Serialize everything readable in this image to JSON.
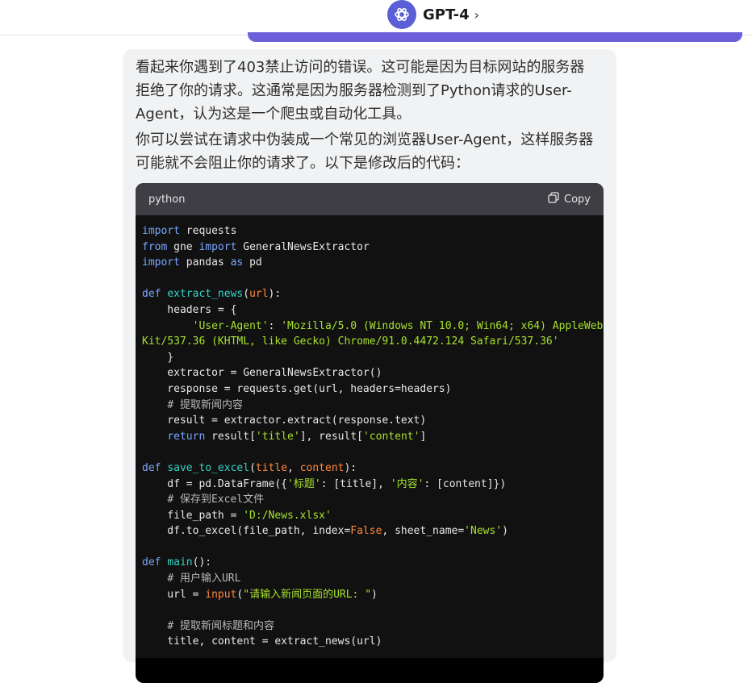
{
  "header": {
    "model": "GPT-4",
    "chevron": "›",
    "logo_icon": "openai-logo"
  },
  "message": {
    "para1": "看起来你遇到了403禁止访问的错误。这可能是因为目标网站的服务器拒绝了你的请求。这通常是因为服务器检测到了Python请求的User-Agent，认为这是一个爬虫或自动化工具。",
    "para2": "你可以尝试在请求中伪装成一个常见的浏览器User-Agent，这样服务器可能就不会阻止你的请求了。以下是修改后的代码："
  },
  "code_block": {
    "language": "python",
    "copy_label": "Copy",
    "copy_icon": "copy-icon",
    "lines": [
      [
        [
          "k",
          "import"
        ],
        [
          "p",
          " requests"
        ]
      ],
      [
        [
          "k",
          "from"
        ],
        [
          "p",
          " gne "
        ],
        [
          "k",
          "import"
        ],
        [
          "p",
          " GeneralNewsExtractor"
        ]
      ],
      [
        [
          "k",
          "import"
        ],
        [
          "p",
          " pandas "
        ],
        [
          "k",
          "as"
        ],
        [
          "p",
          " pd"
        ]
      ],
      [],
      [
        [
          "k",
          "def"
        ],
        [
          "p",
          " "
        ],
        [
          "f",
          "extract_news"
        ],
        [
          "p",
          "("
        ],
        [
          "o",
          "url"
        ],
        [
          "p",
          "):"
        ]
      ],
      [
        [
          "p",
          "    headers = {"
        ]
      ],
      [
        [
          "p",
          "        "
        ],
        [
          "s",
          "'User-Agent'"
        ],
        [
          "p",
          ": "
        ],
        [
          "s",
          "'Mozilla/5.0 (Windows NT 10.0; Win64; x64) AppleWeb"
        ]
      ],
      [
        [
          "s",
          "Kit/537.36 (KHTML, like Gecko) Chrome/91.0.4472.124 Safari/537.36'"
        ]
      ],
      [
        [
          "p",
          "    }"
        ]
      ],
      [
        [
          "p",
          "    extractor = GeneralNewsExtractor()"
        ]
      ],
      [
        [
          "p",
          "    response = requests.get(url, headers=headers)"
        ]
      ],
      [
        [
          "p",
          "    "
        ],
        [
          "c",
          "# 提取新闻内容"
        ]
      ],
      [
        [
          "p",
          "    result = extractor.extract(response.text)"
        ]
      ],
      [
        [
          "p",
          "    "
        ],
        [
          "k",
          "return"
        ],
        [
          "p",
          " result["
        ],
        [
          "s",
          "'title'"
        ],
        [
          "p",
          "], result["
        ],
        [
          "s",
          "'content'"
        ],
        [
          "p",
          "]"
        ]
      ],
      [],
      [
        [
          "k",
          "def"
        ],
        [
          "p",
          " "
        ],
        [
          "f",
          "save_to_excel"
        ],
        [
          "p",
          "("
        ],
        [
          "o",
          "title"
        ],
        [
          "p",
          ", "
        ],
        [
          "o",
          "content"
        ],
        [
          "p",
          "):"
        ]
      ],
      [
        [
          "p",
          "    df = pd.DataFrame({"
        ],
        [
          "s",
          "'标题'"
        ],
        [
          "p",
          ": [title], "
        ],
        [
          "s",
          "'内容'"
        ],
        [
          "p",
          ": [content]})"
        ]
      ],
      [
        [
          "p",
          "    "
        ],
        [
          "c",
          "# 保存到Excel文件"
        ]
      ],
      [
        [
          "p",
          "    file_path = "
        ],
        [
          "s",
          "'D:/News.xlsx'"
        ]
      ],
      [
        [
          "p",
          "    df.to_excel(file_path, index="
        ],
        [
          "o",
          "False"
        ],
        [
          "p",
          ", sheet_name="
        ],
        [
          "s",
          "'News'"
        ],
        [
          "p",
          ")"
        ]
      ],
      [],
      [
        [
          "k",
          "def"
        ],
        [
          "p",
          " "
        ],
        [
          "f",
          "main"
        ],
        [
          "p",
          "():"
        ]
      ],
      [
        [
          "p",
          "    "
        ],
        [
          "c",
          "# 用户输入URL"
        ]
      ],
      [
        [
          "p",
          "    url = "
        ],
        [
          "o",
          "input"
        ],
        [
          "p",
          "("
        ],
        [
          "s",
          "\"请输入新闻页面的URL: \""
        ],
        [
          "p",
          ")"
        ]
      ],
      [],
      [
        [
          "p",
          "    "
        ],
        [
          "c",
          "# 提取新闻标题和内容"
        ]
      ],
      [
        [
          "p",
          "    title, content = extract_news(url)"
        ]
      ]
    ]
  },
  "colors": {
    "user_bubble": "#6c5fd9",
    "assistant_bg": "#f1f2f3",
    "code_header": "#3e3e44",
    "code_bg": "#111111",
    "keyword": "#7aa7ff",
    "function": "#35d3c6",
    "string": "#a6e22e",
    "param": "#ff8a3d",
    "comment": "#b9b9b9"
  }
}
